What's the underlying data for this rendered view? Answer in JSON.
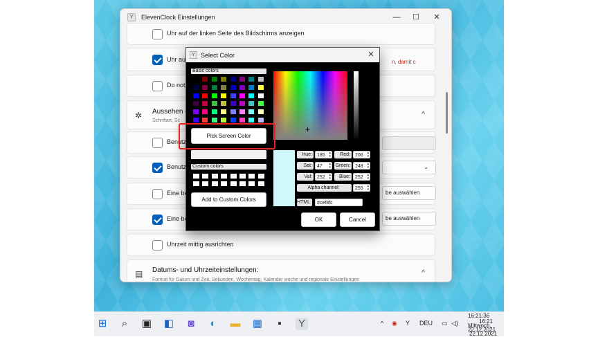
{
  "settings_window": {
    "title": "ElevenClock Einstellungen",
    "minimize": "—",
    "maximize": "☐",
    "close": "✕",
    "rows": {
      "left_side": "Uhr auf der linken Seite des Bildschirms anzeigen",
      "uhr_auf": "Uhr auf",
      "do_not": "Do not",
      "benutz1": "Benutze",
      "benutz2": "Benutze",
      "eine_be1": "Eine be",
      "eine_be2": "Eine be",
      "center_clock": "Uhrzeit mittig ausrichten"
    },
    "red_warning": "n, damit c",
    "appearance": {
      "title": "Aussehen d",
      "subtitle": "Schriftart, Sc",
      "icon": "palette-icon",
      "chevron": "^"
    },
    "buttons": {
      "farbe_auswahlen_1": "be auswählen",
      "farbe_auswahlen_2": "be auswählen"
    },
    "datetime": {
      "title": "Datums- und Uhrzeiteinstellungen:",
      "subtitle": "Format für Datum und Zeit, Sekunden, Wochentag, Kalender woche und regionale Einstellungen",
      "chevron": "^"
    },
    "dropdown_chevron": "⌄"
  },
  "dialog": {
    "title": "Select Color",
    "close": "✕",
    "basic_colors_label": "Basic colors",
    "custom_colors_label": "Custom colors",
    "pick_screen_color": "Pick Screen Color",
    "add_custom": "Add to Custom Colors",
    "ok": "OK",
    "cancel": "Cancel",
    "fields": {
      "hue_label": "Hue:",
      "hue": "185",
      "sat_label": "Sat:",
      "sat": "47",
      "val_label": "Val:",
      "val": "252",
      "red_label": "Red:",
      "red": "206",
      "green_label": "Green:",
      "green": "248",
      "blue_label": "Blue:",
      "blue": "252",
      "alpha_label": "Alpha channel:",
      "alpha": "255",
      "html_label": "HTML:",
      "html": "#cef8fc"
    },
    "preview_color": "#cef8fc",
    "basic_colors": [
      "#000000",
      "#800000",
      "#008000",
      "#808000",
      "#000080",
      "#800080",
      "#008080",
      "#c0c0c0",
      "#000040",
      "#800040",
      "#008040",
      "#808040",
      "#0000c0",
      "#8000c0",
      "#0080c0",
      "#ffff40",
      "#0000ff",
      "#ff0000",
      "#00ff00",
      "#ffff00",
      "#4040ff",
      "#ff00ff",
      "#00ffff",
      "#ffffff",
      "#400040",
      "#c00040",
      "#40c040",
      "#c0c040",
      "#4000c0",
      "#c000c0",
      "#40c0c0",
      "#40ff40",
      "#8000ff",
      "#ff0080",
      "#00ff80",
      "#ffff80",
      "#8080ff",
      "#ff80ff",
      "#80ffff",
      "#ffffc0",
      "#4000ff",
      "#ff4040",
      "#40ff80",
      "#c0ff40",
      "#0040ff",
      "#ff40c0",
      "#40ffff",
      "#c0c0ff"
    ]
  },
  "taskbar": {
    "icons": [
      "windows-start-icon",
      "search-icon",
      "task-view-icon",
      "widgets-icon",
      "chat-icon",
      "edge-icon",
      "file-explorer-icon",
      "store-icon",
      "terminal-icon",
      "elevenclock-icon"
    ],
    "tray_chevron": "^",
    "language": "DEU",
    "clock_time": "16:21:36",
    "clock_time_short": "16:21",
    "clock_day": "Mittwoch,",
    "clock_date": "22.12.2021",
    "clock_date2": "22.12.2021"
  },
  "desktop_letter": "n"
}
